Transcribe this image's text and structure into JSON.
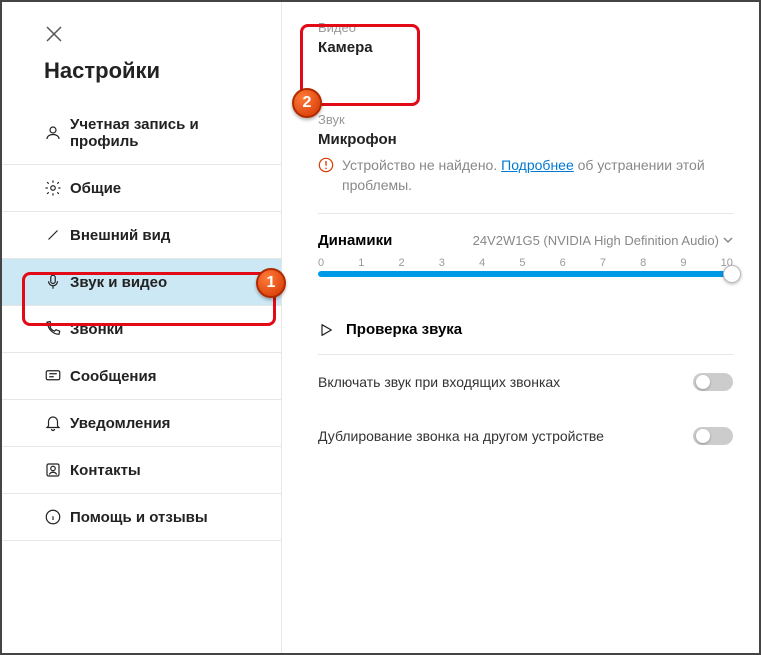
{
  "page_title": "Настройки",
  "sidebar": {
    "items": [
      {
        "label": "Учетная запись и\nпрофиль"
      },
      {
        "label": "Общие"
      },
      {
        "label": "Внешний вид"
      },
      {
        "label": "Звук и видео"
      },
      {
        "label": "Звонки"
      },
      {
        "label": "Сообщения"
      },
      {
        "label": "Уведомления"
      },
      {
        "label": "Контакты"
      },
      {
        "label": "Помощь и отзывы"
      }
    ]
  },
  "video": {
    "section_label": "Видео",
    "title": "Камера"
  },
  "audio": {
    "section_label": "Звук",
    "mic_title": "Микрофон",
    "warning_pre": "Устройство не найдено. ",
    "warning_link": "Подробнее",
    "warning_post": " об устранении этой проблемы.",
    "speakers_title": "Динамики",
    "speakers_device": "24V2W1G5 (NVIDIA High Definition Audio)",
    "slider_ticks": [
      "0",
      "1",
      "2",
      "3",
      "4",
      "5",
      "6",
      "7",
      "8",
      "9",
      "10"
    ],
    "slider_value": 10,
    "test_label": "Проверка звука",
    "toggle_incoming": "Включать звук при входящих звонках",
    "toggle_duplicate": "Дублирование звонка на другом устройстве"
  },
  "badges": {
    "b1": "1",
    "b2": "2"
  }
}
